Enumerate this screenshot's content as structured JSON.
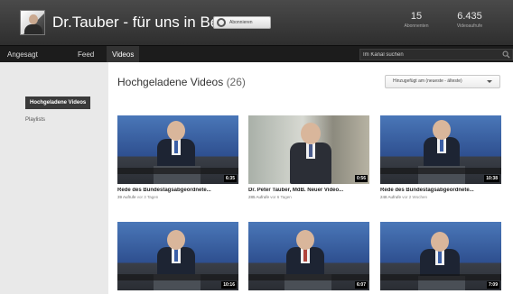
{
  "header": {
    "channel_title": "Dr.Tauber - für uns in Berlin",
    "subscribe_label": "Abonnieren",
    "stats": [
      {
        "value": "15",
        "label": "Abonnenten"
      },
      {
        "value": "6.435",
        "label": "Videoaufrufe"
      }
    ]
  },
  "nav": {
    "tabs": [
      "Angesagt",
      "Feed",
      "Videos"
    ],
    "active_tab": "Videos",
    "search_placeholder": "Im Kanal suchen",
    "search_icon": "search-icon"
  },
  "sidebar": {
    "items": [
      "Hochgeladene Videos",
      "Playlists"
    ],
    "active_item": "Hochgeladene Videos"
  },
  "main": {
    "section_title": "Hochgeladene Videos",
    "section_count": "(26)",
    "sort_label": "Hinzugefügt am (neueste - älteste)",
    "videos": [
      {
        "title": "Rede des Bundestagsabgeordnete...",
        "views": "39 Aufrufe",
        "age": "vor 3 Tagen",
        "duration": "6:35"
      },
      {
        "title": "Dr. Peter Tauber, MdB. Neuer Video...",
        "views": "285 Aufrufe",
        "age": "vor 6 Tagen",
        "duration": "0:56"
      },
      {
        "title": "Rede des Bundestagsabgeordnete...",
        "views": "248 Aufrufe",
        "age": "vor 2 Wochen",
        "duration": "10:38"
      },
      {
        "title": "",
        "views": "",
        "age": "",
        "duration": "10:16"
      },
      {
        "title": "",
        "views": "",
        "age": "",
        "duration": "6:07"
      },
      {
        "title": "",
        "views": "",
        "age": "",
        "duration": "7:09"
      }
    ]
  },
  "colors": {
    "header_bg": "#3a3a3a",
    "nav_bg": "#1c1c1c",
    "bundestag_blue": "#2f4a8a",
    "active_item_bg": "#3a3a3a"
  }
}
